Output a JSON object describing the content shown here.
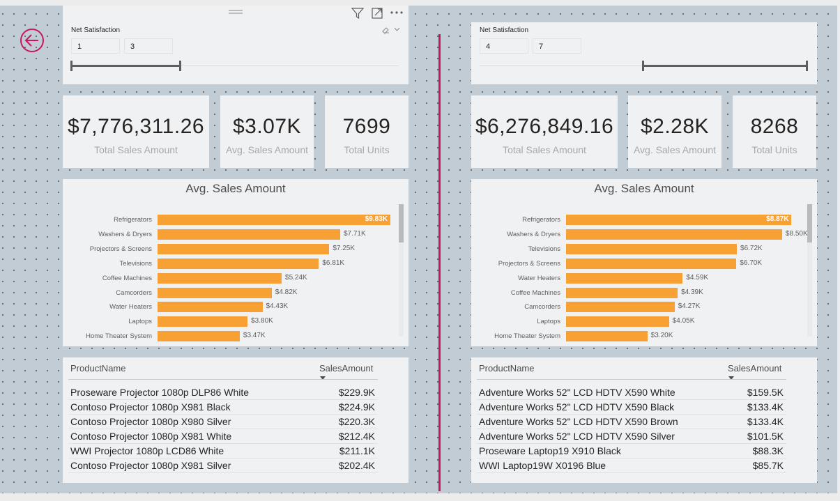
{
  "left": {
    "slicer": {
      "title": "Net Satisfaction",
      "min": "1",
      "max": "3"
    },
    "kpis": {
      "total_sales": {
        "value": "$7,776,311.26",
        "label": "Total Sales Amount"
      },
      "avg_sales": {
        "value": "$3.07K",
        "label": "Avg. Sales Amount"
      },
      "total_units": {
        "value": "7699",
        "label": "Total Units"
      }
    },
    "chart_title": "Avg. Sales Amount",
    "table": {
      "columns": [
        "ProductName",
        "SalesAmount"
      ],
      "rows": [
        {
          "name": "Proseware Projector 1080p DLP86 White",
          "amount": "$229.9K"
        },
        {
          "name": "Contoso Projector 1080p X981 Black",
          "amount": "$224.9K"
        },
        {
          "name": "Contoso Projector 1080p X980 Silver",
          "amount": "$220.3K"
        },
        {
          "name": "Contoso Projector 1080p X981 White",
          "amount": "$212.4K"
        },
        {
          "name": "WWI Projector 1080p LCD86 White",
          "amount": "$211.1K"
        },
        {
          "name": "Contoso Projector 1080p X981 Silver",
          "amount": "$202.4K"
        }
      ]
    }
  },
  "right": {
    "slicer": {
      "title": "Net Satisfaction",
      "min": "4",
      "max": "7"
    },
    "kpis": {
      "total_sales": {
        "value": "$6,276,849.16",
        "label": "Total Sales Amount"
      },
      "avg_sales": {
        "value": "$2.28K",
        "label": "Avg. Sales Amount"
      },
      "total_units": {
        "value": "8268",
        "label": "Total Units"
      }
    },
    "chart_title": "Avg. Sales Amount",
    "table": {
      "columns": [
        "ProductName",
        "SalesAmount"
      ],
      "rows": [
        {
          "name": "Adventure Works 52\" LCD HDTV X590 White",
          "amount": "$159.5K"
        },
        {
          "name": "Adventure Works 52\" LCD HDTV X590 Black",
          "amount": "$133.4K"
        },
        {
          "name": "Adventure Works 52\" LCD HDTV X590 Brown",
          "amount": "$133.4K"
        },
        {
          "name": "Adventure Works 52\" LCD HDTV X590 Silver",
          "amount": "$101.5K"
        },
        {
          "name": "Proseware Laptop19 X910 Black",
          "amount": "$88.3K"
        },
        {
          "name": "WWI Laptop19W X0196 Blue",
          "amount": "$85.7K"
        }
      ]
    }
  },
  "icons": {
    "back": "back-arrow-icon",
    "filter": "filter-icon",
    "focus": "focus-mode-icon",
    "more": "more-options-icon",
    "drag": "drag-handle-icon",
    "eraser": "clear-selections-icon",
    "chevron": "chevron-down-icon"
  },
  "colors": {
    "bar": "#f7a135",
    "accent": "#c8175b",
    "canvas": "#c1ccd4",
    "card": "#eff1f3"
  },
  "chart_data": [
    {
      "type": "bar",
      "orientation": "horizontal",
      "title": "Avg. Sales Amount",
      "categories": [
        "Refrigerators",
        "Washers & Dryers",
        "Projectors & Screens",
        "Televisions",
        "Coffee Machines",
        "Camcorders",
        "Water Heaters",
        "Laptops",
        "Home Theater System"
      ],
      "values": [
        9830,
        7710,
        7250,
        6810,
        5240,
        4820,
        4430,
        3800,
        3470
      ],
      "value_labels": [
        "$9.83K",
        "$7.71K",
        "$7.25K",
        "$6.81K",
        "$5.24K",
        "$4.82K",
        "$4.43K",
        "$3.80K",
        "$3.47K"
      ],
      "xlim": [
        0,
        9830
      ]
    },
    {
      "type": "bar",
      "orientation": "horizontal",
      "title": "Avg. Sales Amount",
      "categories": [
        "Refrigerators",
        "Washers & Dryers",
        "Televisions",
        "Projectors & Screens",
        "Water Heaters",
        "Coffee Machines",
        "Camcorders",
        "Laptops",
        "Home Theater System"
      ],
      "values": [
        8870,
        8500,
        6720,
        6700,
        4590,
        4390,
        4270,
        4050,
        3200
      ],
      "value_labels": [
        "$8.87K",
        "$8.50K",
        "$6.72K",
        "$6.70K",
        "$4.59K",
        "$4.39K",
        "$4.27K",
        "$4.05K",
        "$3.20K"
      ],
      "xlim": [
        0,
        9160
      ]
    }
  ]
}
